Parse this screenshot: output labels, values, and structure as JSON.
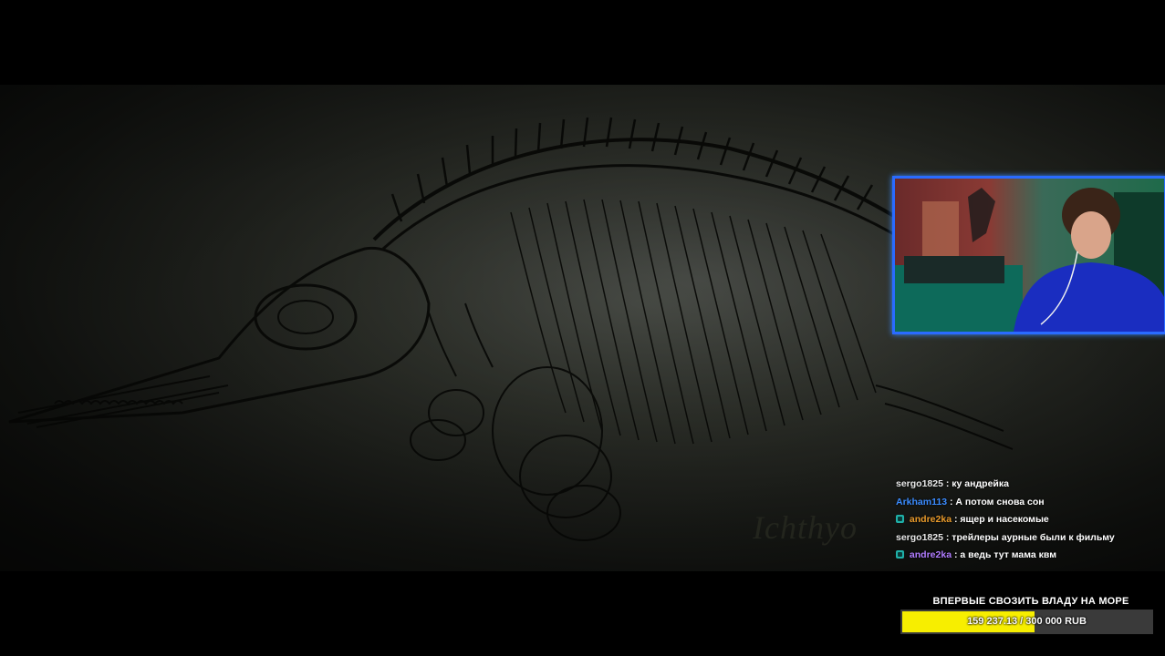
{
  "video": {
    "caption_fragment": "Ichthyo"
  },
  "webcam": {
    "accent_color": "#2a6bff"
  },
  "chat": {
    "messages": [
      {
        "user": "sergo1825",
        "user_color": "#e8e8e8",
        "badge": false,
        "text": "ку андрейка"
      },
      {
        "user": "Arkham113",
        "user_color": "#3b8cff",
        "badge": false,
        "text": "А потом снова сон"
      },
      {
        "user": "andre2ka",
        "user_color": "#e89a2b",
        "badge": true,
        "text": "ящер и насекомые"
      },
      {
        "user": "sergo1825",
        "user_color": "#e8e8e8",
        "badge": false,
        "text": "трейлеры аурные были к фильму"
      },
      {
        "user": "andre2ka",
        "user_color": "#b07cff",
        "badge": true,
        "text": "а ведь тут мама квм"
      }
    ]
  },
  "goal": {
    "title": "ВПЕРВЫЕ СВОЗИТЬ ВЛАДУ НА МОРЕ",
    "progress_text": "159 237.13 / 300 000 RUB",
    "progress_fraction": 0.531,
    "fill_color": "#f7ee00"
  }
}
